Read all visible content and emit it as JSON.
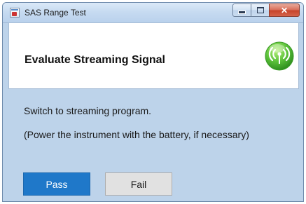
{
  "window": {
    "title": "SAS Range Test",
    "controls": {
      "minimize_icon": "minimize-icon",
      "maximize_icon": "maximize-icon",
      "close_icon": "close-icon",
      "close_glyph": "✕"
    }
  },
  "header": {
    "title": "Evaluate Streaming Signal",
    "icon": "streaming-signal-icon",
    "icon_color": "#5cc23a"
  },
  "instructions": {
    "line1": "Switch to streaming program.",
    "line2": "(Power the instrument with the battery, if necessary)"
  },
  "buttons": {
    "pass_label": "Pass",
    "fail_label": "Fail",
    "pass_color": "#1f78c9"
  }
}
